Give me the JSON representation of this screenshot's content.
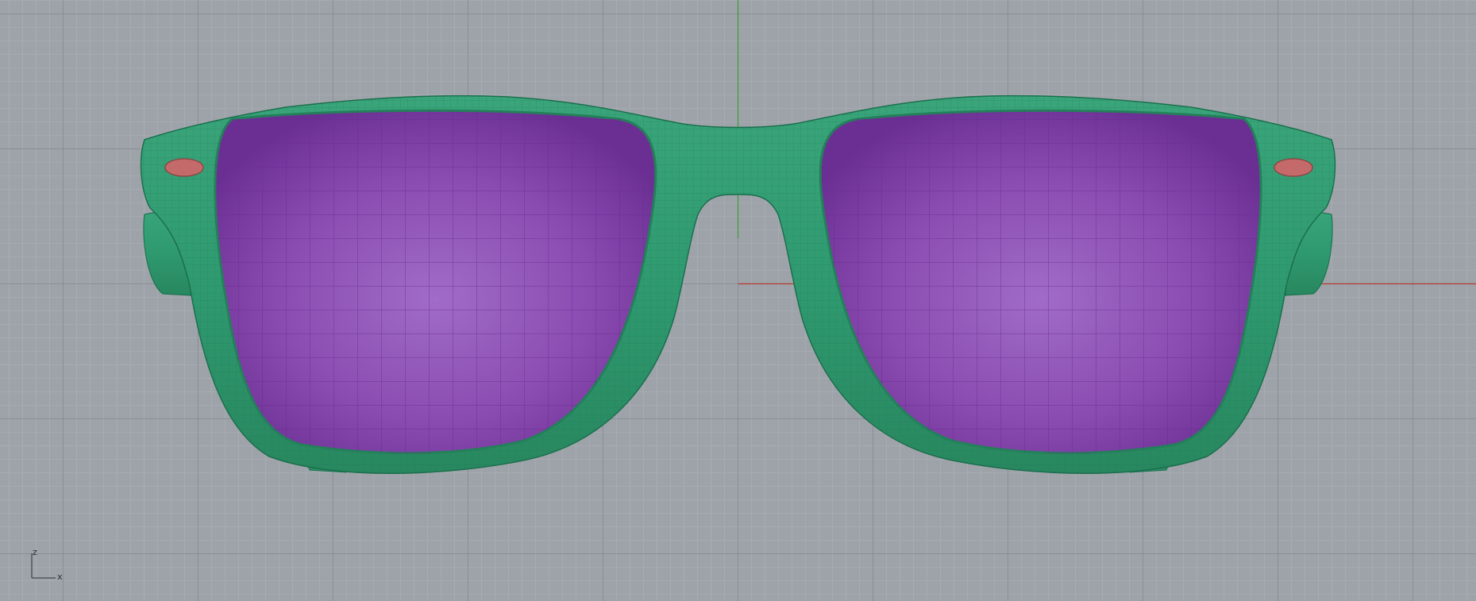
{
  "viewport": {
    "view": "front",
    "background_color": "#9ea3a9",
    "grid_minor_color": "#a9aeb4",
    "grid_major_color": "#8a8f96",
    "x_axis_color": "#b53a2e",
    "z_axis_color": "#3f9a3a"
  },
  "model": {
    "object": "sunglasses",
    "display_mode": "shaded-wireframe",
    "frame_color": "#2f9a70",
    "frame_wire_color": "#1d7451",
    "lens_color": "#8a4bb0",
    "lens_wire_color": "#6a2a92",
    "rivet_color": "#c46a6a"
  },
  "axis_widget": {
    "vertical_label": "z",
    "horizontal_label": "x"
  }
}
